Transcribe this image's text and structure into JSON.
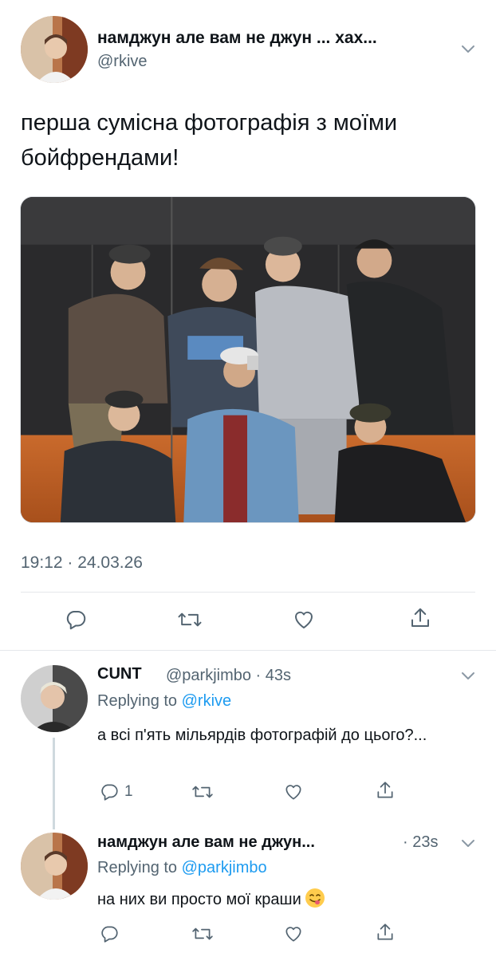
{
  "main_tweet": {
    "display_name": "намджун але вам не джун ... хах...",
    "handle": "@rkive",
    "text": "перша сумісна фотографія з моїми бойфрендами!",
    "timestamp": "19:12 · 24.03.26"
  },
  "reply1": {
    "display_name": "CUNT",
    "handle_time": "@parkjimbo · 43s",
    "replying_prefix": "Replying to ",
    "replying_to": "@rkive",
    "text": "а всі п'ять мільярдів фотографій до цього?...",
    "reply_count": "1"
  },
  "reply2": {
    "display_name": "намджун але вам не джун...",
    "time": "· 23s",
    "replying_prefix": "Replying to ",
    "replying_to": "@parkjimbo",
    "text": "на них ви просто мої краши"
  },
  "icons": [
    "chevron-down-icon",
    "reply-icon",
    "retweet-icon",
    "like-icon",
    "share-icon",
    "savoring-food-emoji"
  ],
  "colors": {
    "link": "#1d9bf0",
    "secondary": "#536471",
    "text": "#0f1419",
    "divider": "#e5e8eb"
  }
}
